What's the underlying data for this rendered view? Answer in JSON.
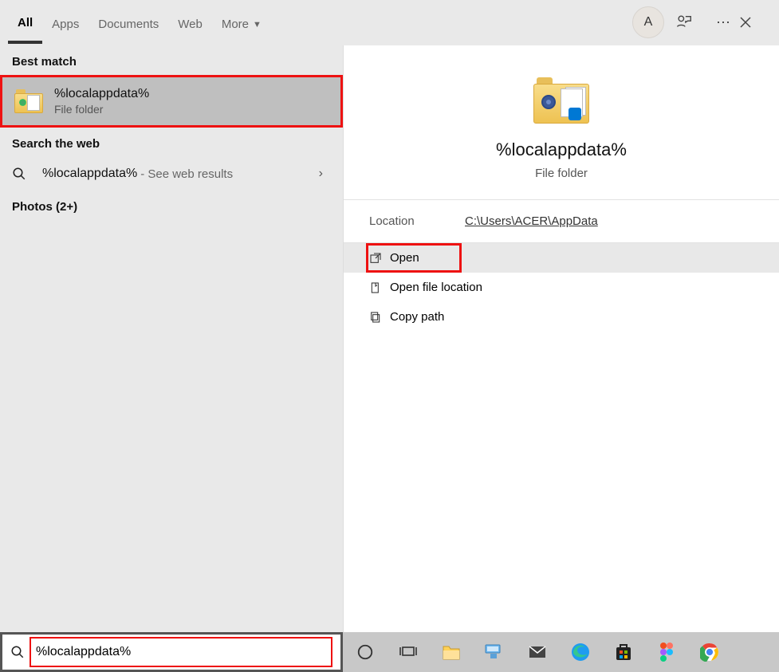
{
  "tabs": {
    "all": "All",
    "apps": "Apps",
    "documents": "Documents",
    "web": "Web",
    "more": "More"
  },
  "avatar_initial": "A",
  "sections": {
    "best_match": "Best match",
    "search_web": "Search the web",
    "photos": "Photos (2+)"
  },
  "best_result": {
    "title": "%localappdata%",
    "subtitle": "File folder"
  },
  "web_result": {
    "query": "%localappdata%",
    "hint": "- See web results"
  },
  "preview": {
    "title": "%localappdata%",
    "kind": "File folder",
    "location_label": "Location",
    "location_value": "C:\\Users\\ACER\\AppData"
  },
  "actions": {
    "open": "Open",
    "open_loc": "Open file location",
    "copy_path": "Copy path"
  },
  "search_value": "%localappdata%"
}
